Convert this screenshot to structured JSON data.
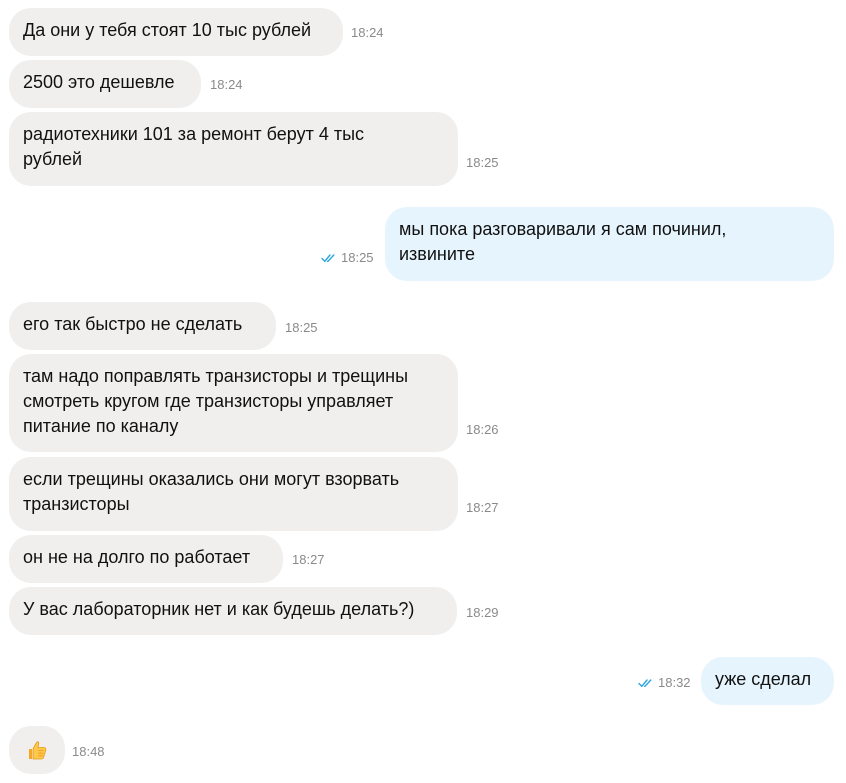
{
  "messages": [
    {
      "text": "Да они у тебя стоят 10 тыс рублей",
      "time": "18:24"
    },
    {
      "text": "2500 это дешевле",
      "time": "18:24"
    },
    {
      "text": "радиотехники 101 за ремонт берут 4 тыс\nрублей",
      "time": "18:25"
    },
    {
      "text": "мы пока разговаривали я сам починил,\nизвините",
      "time": "18:25"
    },
    {
      "text": "его так быстро не сделать",
      "time": "18:25"
    },
    {
      "text": "там надо поправлять транзисторы и трещины\nсмотреть кругом где транзисторы управляет\nпитание по каналу",
      "time": "18:26"
    },
    {
      "text": "если трещины оказались они могут взорвать\nтранзисторы",
      "time": "18:27"
    },
    {
      "text": "он не на долго по работает",
      "time": "18:27"
    },
    {
      "text": "У вас лабораторник нет и как будешь делать?)",
      "time": "18:29"
    },
    {
      "text": "уже сделал",
      "time": "18:32"
    },
    {
      "emoji": "thumbs-up-icon",
      "time": "18:48"
    }
  ],
  "colors": {
    "incoming_bubble": "#f0efee",
    "outgoing_bubble": "#e6f5fd",
    "read_check": "#2aa3e0",
    "timestamp": "#8a8a8a"
  }
}
